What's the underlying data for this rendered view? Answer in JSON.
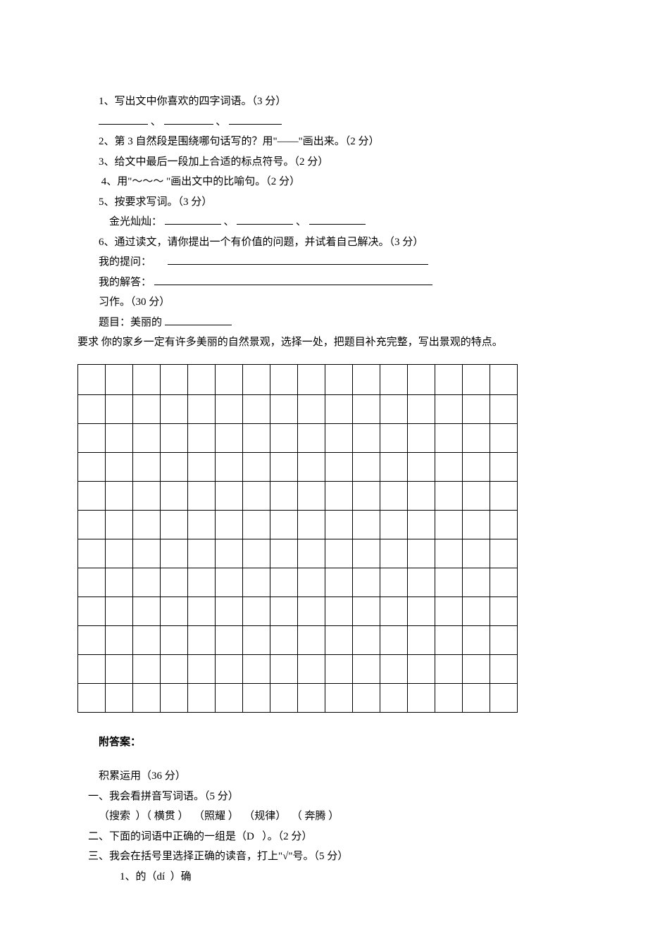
{
  "q1": "1、写出文中你喜欢的四字词语。（3 分）",
  "q2": "2、第 3 自然段是围绕哪句话写的？用\"——\"画出来。（2 分）",
  "q3": "3、给文中最后一段加上合适的标点符号。（2 分）",
  "q4": "4、用\"～～～ \"画出文中的比喻句。（2 分）",
  "q5": "5、按要求写词。（3 分）",
  "q5_sub": "金光灿灿：",
  "q6": "6、通过读文，请你提出一个有价值的问题，并试着自己解决。（3 分）",
  "q6_a": "我的提问：",
  "q6_b": "我的解答：",
  "essay_header": "习作。（30 分）",
  "essay_title_prefix": "题目：美丽的",
  "essay_req": "要求 你的家乡一定有许多美丽的自然景观，选择一处，把题目补充完整，写出景观的特点。",
  "answers_header": "附答案：",
  "ans_section": "积累运用（36 分）",
  "ans1": "一、我会看拼音写词语。（5 分）",
  "ans1_items": "（搜索  ）（ 横贯 ）  （照耀 ）  （规律）  （ 奔腾 ）",
  "ans2": "二、下面的词语中正确的一组是（D   ）。（2 分）",
  "ans3": "三、我会在括号里选择正确的读音，打上\"√\"号。（5 分）",
  "ans3_1": "1、的（dí  ）确",
  "sep_dun": "、"
}
